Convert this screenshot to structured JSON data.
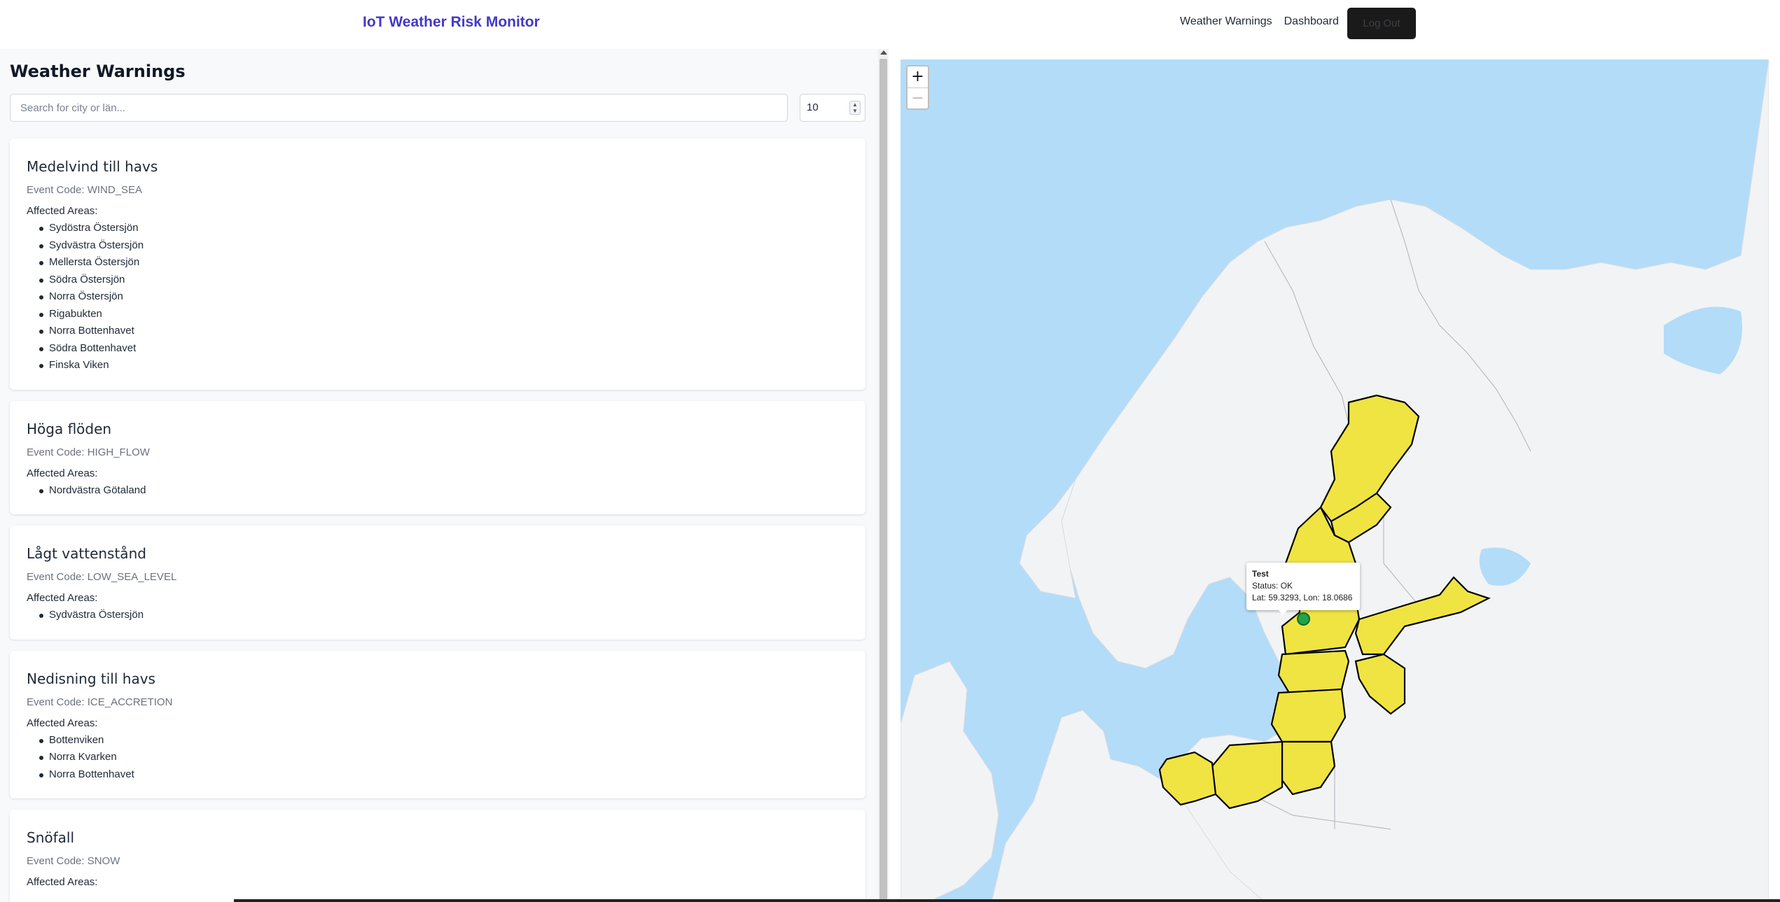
{
  "header": {
    "brand": "IoT Weather Risk Monitor",
    "nav": [
      "Weather Warnings",
      "Dashboard"
    ],
    "logout_label": "Log Out"
  },
  "warnings_panel": {
    "title": "Weather Warnings",
    "search_placeholder": "Search for city or län...",
    "limit_value": "10",
    "affected_label": "Affected Areas:",
    "warnings": [
      {
        "title": "Medelvind till havs",
        "code": "Event Code: WIND_SEA",
        "areas": [
          "Sydöstra Östersjön",
          "Sydvästra Östersjön",
          "Mellersta Östersjön",
          "Södra Östersjön",
          "Norra Östersjön",
          "Rigabukten",
          "Norra Bottenhavet",
          "Södra Bottenhavet",
          "Finska Viken"
        ]
      },
      {
        "title": "Höga flöden",
        "code": "Event Code: HIGH_FLOW",
        "areas": [
          "Nordvästra Götaland"
        ]
      },
      {
        "title": "Lågt vattenstånd",
        "code": "Event Code: LOW_SEA_LEVEL",
        "areas": [
          "Sydvästra Östersjön"
        ]
      },
      {
        "title": "Nedisning till havs",
        "code": "Event Code: ICE_ACCRETION",
        "areas": [
          "Bottenviken",
          "Norra Kvarken",
          "Norra Bottenhavet"
        ]
      },
      {
        "title": "Snöfall",
        "code": "Event Code: SNOW",
        "areas": []
      }
    ]
  },
  "map": {
    "zoom_in": "+",
    "zoom_out": "−",
    "popup": {
      "title": "Test",
      "status": "Status: OK",
      "coords": "Lat: 59.3293, Lon: 18.0686"
    },
    "colors": {
      "water": "#b3dcf9",
      "land": "#f2f3f5",
      "warning_fill": "#f0e442",
      "marker": "#21a447"
    }
  }
}
